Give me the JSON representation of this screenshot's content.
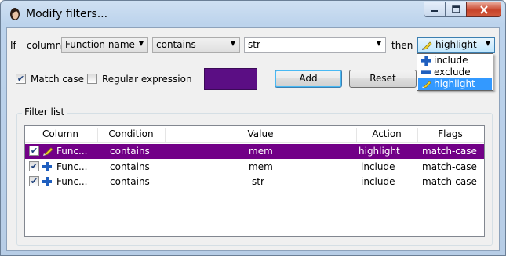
{
  "window": {
    "title": "Modify filters...",
    "icon": "app-face-icon"
  },
  "filter_row": {
    "if_label": "If",
    "column_label": "column",
    "column_value": "Function name",
    "condition_value": "contains",
    "text_value": "str",
    "then_label": "then",
    "action_value": "highlight"
  },
  "options": {
    "match_case_label": "Match case",
    "match_case_checked": true,
    "regex_label": "Regular expression",
    "regex_checked": false,
    "highlight_color": "#5b0e84"
  },
  "buttons": {
    "add": "Add",
    "reset": "Reset"
  },
  "action_dropdown": {
    "items": [
      {
        "label": "include",
        "icon": "plus-icon"
      },
      {
        "label": "exclude",
        "icon": "minus-icon"
      },
      {
        "label": "highlight",
        "icon": "highlighter-icon",
        "selected": true
      }
    ]
  },
  "filter_list": {
    "title": "Filter list",
    "columns": [
      "Column",
      "Condition",
      "Value",
      "Action",
      "Flags"
    ],
    "rows": [
      {
        "checked": true,
        "icon": "highlighter-icon",
        "column": "Func...",
        "condition": "contains",
        "value": "mem",
        "action": "highlight",
        "flags": "match-case",
        "selected": true
      },
      {
        "checked": true,
        "icon": "plus-icon",
        "column": "Func...",
        "condition": "contains",
        "value": "mem",
        "action": "include",
        "flags": "match-case",
        "selected": false
      },
      {
        "checked": true,
        "icon": "plus-icon",
        "column": "Func...",
        "condition": "contains",
        "value": "str",
        "action": "include",
        "flags": "match-case",
        "selected": false
      }
    ]
  },
  "colors": {
    "selection": "#720087",
    "dropdown_highlight": "#3399ff",
    "accent_blue": "#1f5fbf"
  }
}
